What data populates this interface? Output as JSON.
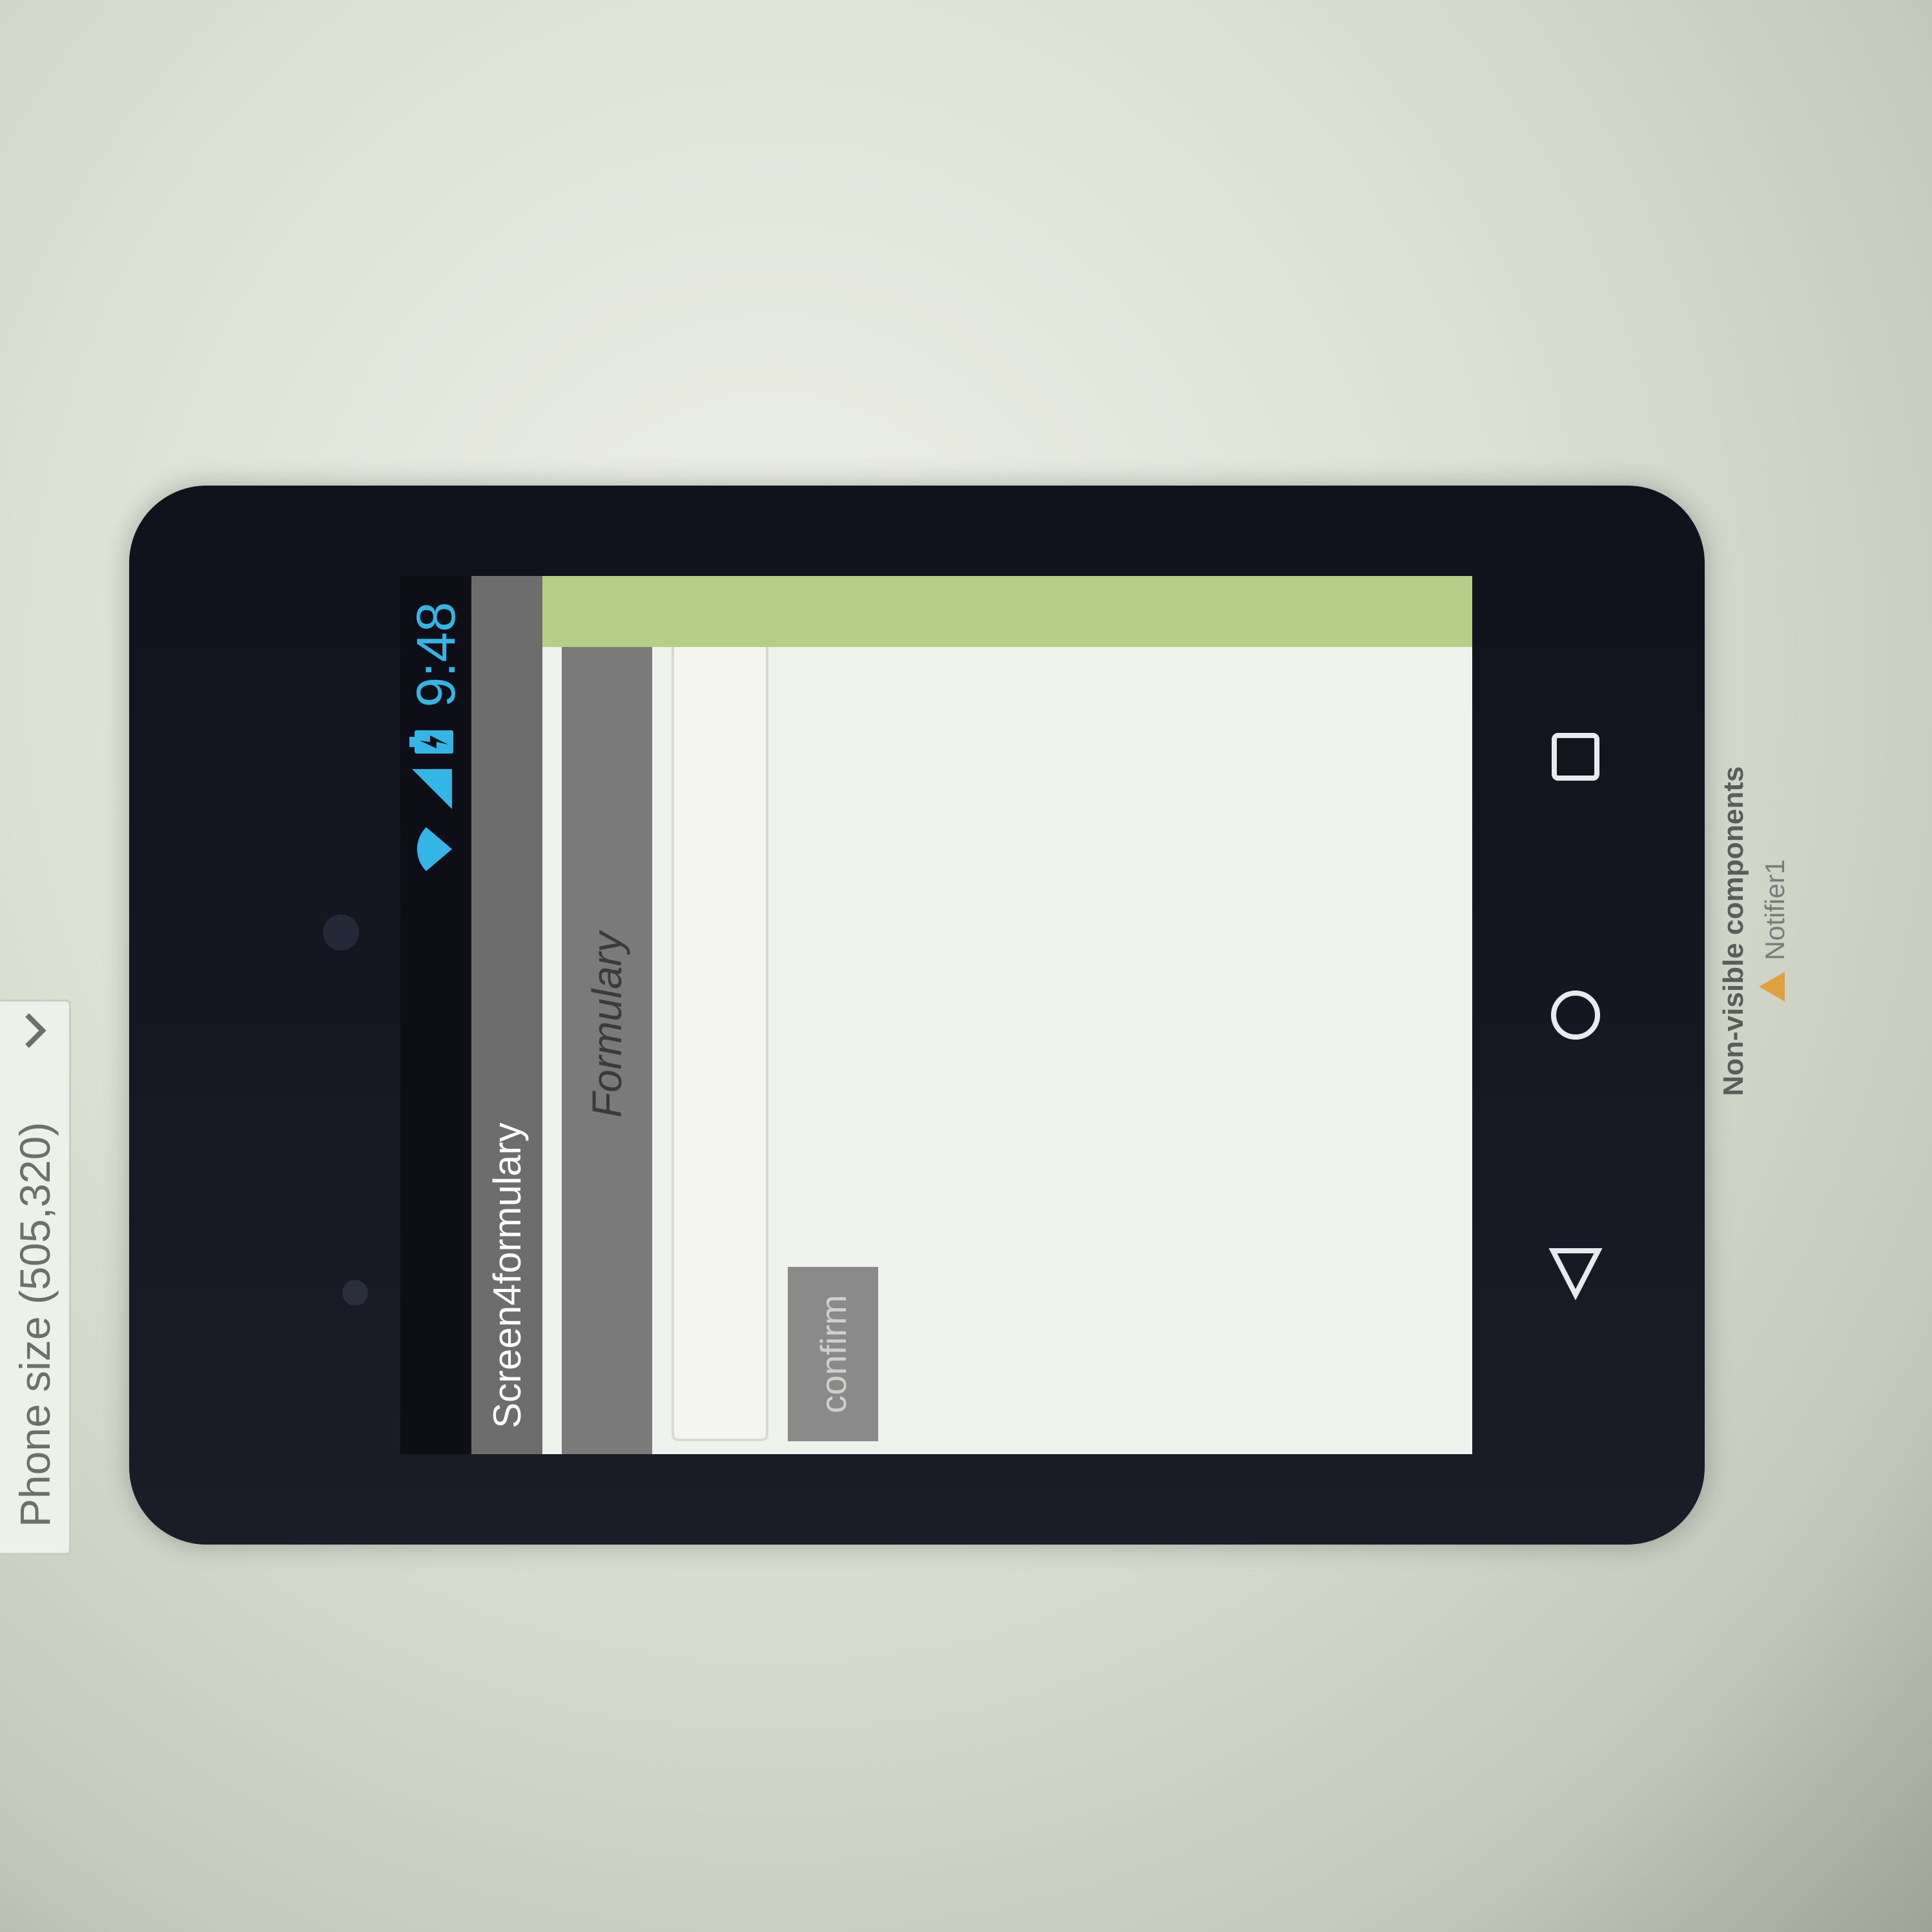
{
  "designer": {
    "phone_size_label": "Phone size (505,320)"
  },
  "status_bar": {
    "time": "9:48",
    "icons": [
      "wifi-icon",
      "signal-icon",
      "battery-icon"
    ],
    "accent_color": "#33b5e5"
  },
  "screen": {
    "title": "Screen4formulary",
    "label_text": "Formulary",
    "textbox_value": "",
    "confirm_label": "confirm"
  },
  "nav_bar": {
    "icons": [
      "back-icon",
      "home-icon",
      "recents-icon"
    ]
  },
  "non_visible": {
    "heading": "Non-visible components",
    "items": [
      {
        "label": "Notifier1",
        "icon": "warning-icon"
      }
    ]
  }
}
